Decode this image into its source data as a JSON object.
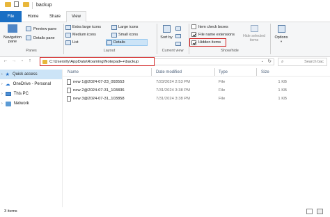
{
  "window": {
    "title": "backup"
  },
  "tabs": {
    "file": "File",
    "home": "Home",
    "share": "Share",
    "view": "View"
  },
  "ribbon": {
    "panes": {
      "navigation_pane": "Navigation pane",
      "preview_pane": "Preview pane",
      "details_pane": "Details pane",
      "label": "Panes"
    },
    "layout": {
      "items": [
        "Extra large icons",
        "Large icons",
        "Medium icons",
        "Small icons",
        "List",
        "Details"
      ],
      "selected": "Details",
      "label": "Layout"
    },
    "current_view": {
      "sort_by": "Sort by",
      "label": "Current view"
    },
    "show_hide": {
      "item_check_boxes": "Item check boxes",
      "file_name_extensions": "File name extensions",
      "hidden_items": "Hidden items",
      "hide_selected": "Hide selected items",
      "label": "Show/hide"
    },
    "options": "Options"
  },
  "address": {
    "path": "C:\\Users\\fy\\AppData\\Roaming\\Notepad++\\backup",
    "search_placeholder": "Search bac"
  },
  "nav": {
    "items": [
      "Quick access",
      "OneDrive - Personal",
      "This PC",
      "Network"
    ]
  },
  "columns": {
    "name": "Name",
    "date": "Date modified",
    "type": "Type",
    "size": "Size"
  },
  "files": [
    {
      "name": "new 1@2024-07-23_093553",
      "date": "7/23/2024 2:53 PM",
      "type": "File",
      "size": "1 KB"
    },
    {
      "name": "new 2@2024-07-31_103836",
      "date": "7/31/2024 3:38 PM",
      "type": "File",
      "size": "1 KB"
    },
    {
      "name": "new 3@2024-07-31_103858",
      "date": "7/31/2024 3:38 PM",
      "type": "File",
      "size": "1 KB"
    }
  ],
  "status": {
    "count": "3 items"
  },
  "colors": {
    "accent": "#1a6fc4",
    "highlight": "#d11f1f",
    "selection": "#cce4f7"
  }
}
